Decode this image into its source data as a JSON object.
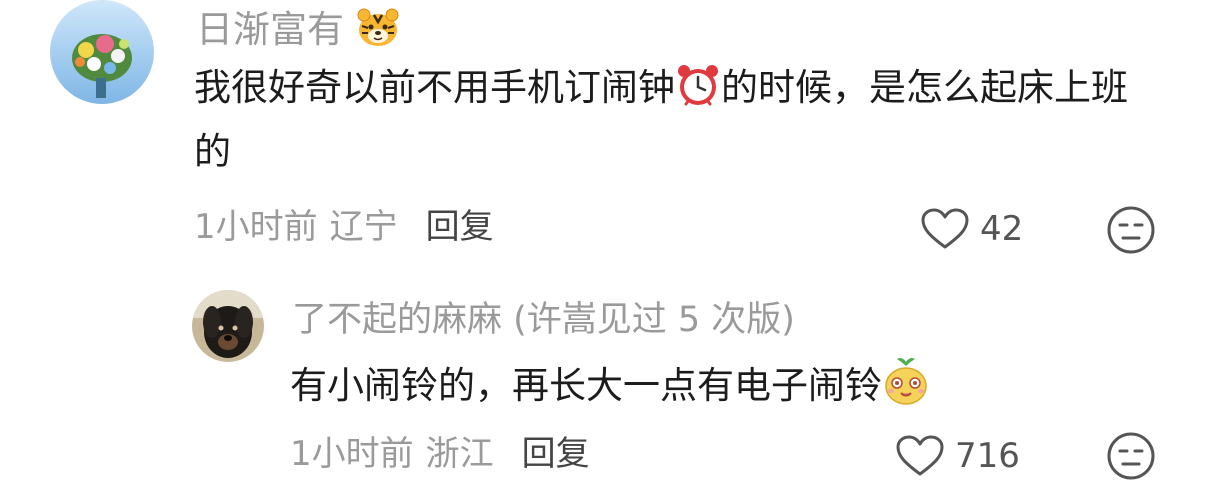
{
  "comments": [
    {
      "username": "日渐富有",
      "username_emoji": "tiger-face-emoji",
      "text_before_emoji": "我很好奇以前不用手机订闹钟",
      "inline_emoji": "alarm-clock-emoji",
      "text_after_emoji": "的时候，是怎么起床上班的",
      "time": "1小时前",
      "location": "辽宁",
      "reply_label": "回复",
      "likes": "42"
    },
    {
      "username": "了不起的麻麻 (许嵩见过 5 次版)",
      "text_before_emoji": "有小闹铃的，再长大一点有电子闹铃",
      "inline_emoji": "cute-sprout-face-emoji",
      "time": "1小时前",
      "location": "浙江",
      "reply_label": "回复",
      "likes": "716"
    }
  ],
  "colors": {
    "username": "#9a9a9a",
    "text": "#1c1c1c",
    "meta": "#9a9a9a",
    "reply": "#444444"
  }
}
